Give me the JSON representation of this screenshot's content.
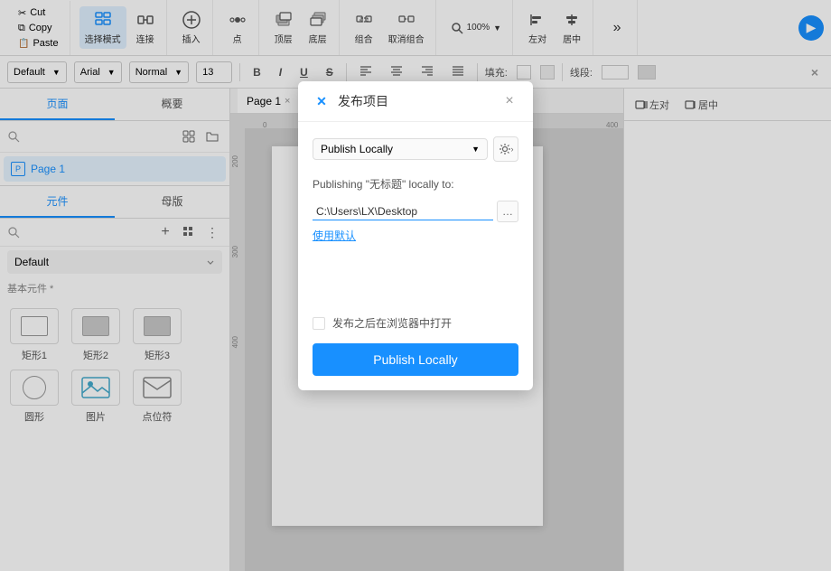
{
  "toolbar": {
    "cut_label": "Cut",
    "copy_label": "Copy",
    "paste_label": "Paste",
    "select_mode_label": "选择模式",
    "connect_label": "连接",
    "insert_label": "插入",
    "point_label": "点",
    "layer_up_label": "顶层",
    "layer_down_label": "底层",
    "group_label": "组合",
    "ungroup_label": "取消组合",
    "left_label": "左对",
    "center_label": "居中",
    "more_label": "…",
    "preview_label": "预览"
  },
  "format_bar": {
    "default_label": "Default",
    "font_label": "Arial",
    "style_label": "Normal",
    "size_label": "13",
    "bold_label": "B",
    "italic_label": "I",
    "underline_label": "U",
    "strikethrough_label": "S",
    "align_left_label": "≡",
    "align_center_label": "≡",
    "fill_label": "填充:",
    "stroke_label": "线段:",
    "close_label": "×"
  },
  "left_sidebar": {
    "tab_pages": "页面",
    "tab_outline": "概要",
    "search_placeholder": "",
    "page_item": "Page 1",
    "components_tab": "元件",
    "masters_tab": "母版",
    "default_group": "Default",
    "basic_components_title": "基本元件 *",
    "items": [
      {
        "label": "矩形1"
      },
      {
        "label": "矩形2"
      },
      {
        "label": "矩形3"
      },
      {
        "label": "圆形"
      },
      {
        "label": "图片"
      },
      {
        "label": "点位符"
      }
    ]
  },
  "canvas": {
    "tab_label": "Page 1"
  },
  "right_sidebar": {
    "left_label": "左对",
    "center_label": "居中"
  },
  "dialog": {
    "title": "发布项目",
    "close_label": "×",
    "type_label": "Publish Locally",
    "info_text": "Publishing \"无标题\" locally to:",
    "path_value": "C:\\Users\\LX\\Desktop",
    "default_link": "使用默认",
    "checkbox_label": "发布之后在浏览器中打开",
    "publish_btn_label": "Publish Locally",
    "logo": "✕"
  }
}
